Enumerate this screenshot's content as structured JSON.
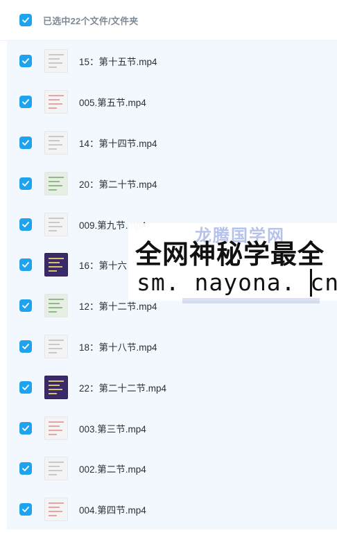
{
  "header": {
    "summary": "已选中22个文件/文件夹",
    "checked": true
  },
  "files": [
    {
      "name": "15：第十五节.mp4",
      "checked": true,
      "thumb": "light"
    },
    {
      "name": "005.第五节.mp4",
      "checked": true,
      "thumb": "pink"
    },
    {
      "name": "14：第十四节.mp4",
      "checked": true,
      "thumb": "light"
    },
    {
      "name": "20：第二十节.mp4",
      "checked": true,
      "thumb": "green"
    },
    {
      "name": "009.第九节.mp4",
      "checked": true,
      "thumb": "light"
    },
    {
      "name": "16：第十六",
      "checked": true,
      "thumb": "dark"
    },
    {
      "name": "12：第十二节.mp4",
      "checked": true,
      "thumb": "green"
    },
    {
      "name": "18：第十八节.mp4",
      "checked": true,
      "thumb": "light"
    },
    {
      "name": "22：第二十二节.mp4",
      "checked": true,
      "thumb": "dark"
    },
    {
      "name": "003.第三节.mp4",
      "checked": true,
      "thumb": "pink"
    },
    {
      "name": "002.第二节.mp4",
      "checked": true,
      "thumb": "light"
    },
    {
      "name": "004.第四节.mp4",
      "checked": true,
      "thumb": "pink"
    }
  ],
  "watermark": {
    "line1": "全网神秘学最全",
    "line2": "sm. nayona. cn",
    "back_text": "龙腾国学网"
  },
  "colors": {
    "accent": "#1fa3ee",
    "list_bg": "#f2f8fd"
  }
}
